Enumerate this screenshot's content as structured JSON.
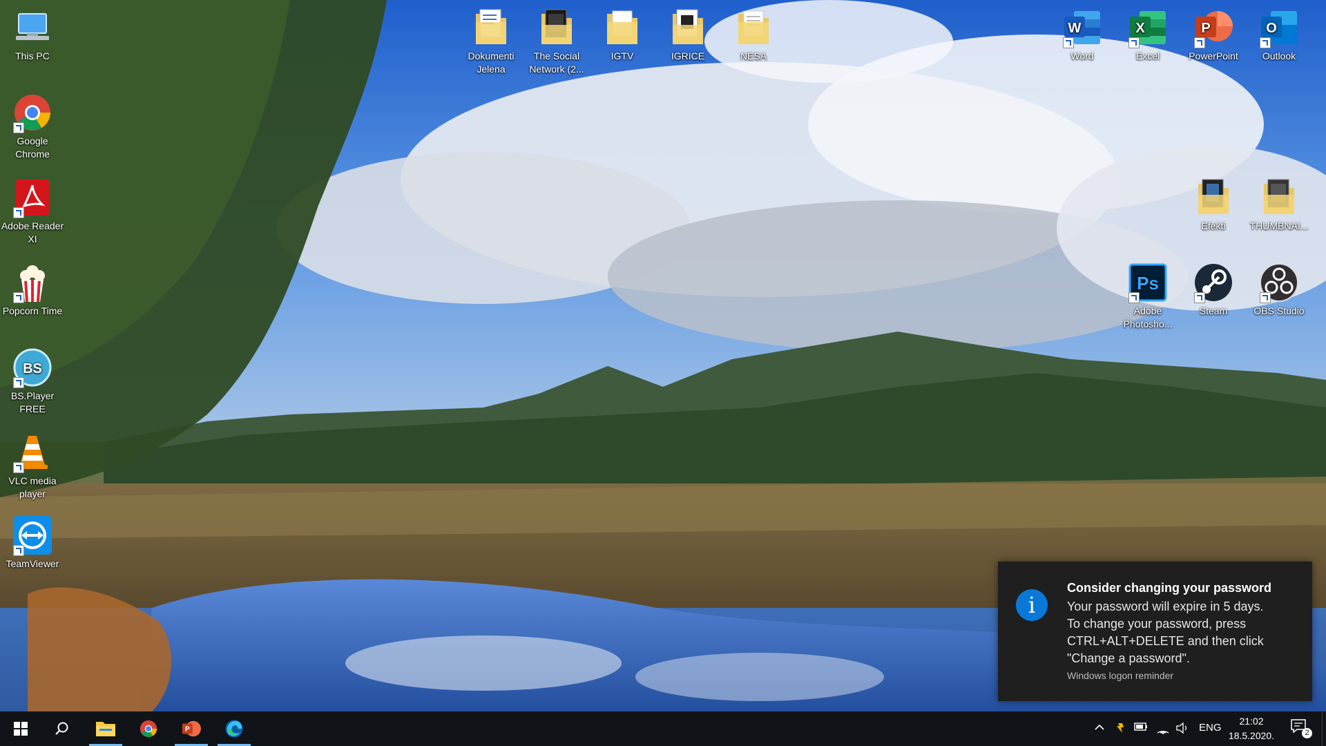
{
  "desktop": {
    "left_icons": [
      {
        "name": "this-pc",
        "label": "This PC",
        "icon": "computer-icon"
      },
      {
        "name": "google-chrome",
        "label": "Google Chrome",
        "icon": "chrome-icon"
      },
      {
        "name": "adobe-reader",
        "label": "Adobe Reader XI",
        "icon": "acrobat-icon"
      },
      {
        "name": "popcorn-time",
        "label": "Popcorn Time",
        "icon": "popcorn-icon"
      },
      {
        "name": "bsplayer",
        "label": "BS.Player FREE",
        "icon": "bsplayer-icon"
      },
      {
        "name": "vlc",
        "label": "VLC media player",
        "icon": "vlc-cone-icon"
      },
      {
        "name": "teamviewer",
        "label": "TeamViewer",
        "icon": "teamviewer-icon"
      }
    ],
    "top_icons": [
      {
        "name": "dokumenti-jelena",
        "label": "Dokumenti Jelena",
        "icon": "folder-icon"
      },
      {
        "name": "the-social-network",
        "label": "The Social Network (2...",
        "icon": "folder-icon"
      },
      {
        "name": "igtv",
        "label": "IGTV",
        "icon": "folder-icon"
      },
      {
        "name": "igrice",
        "label": "IGRICE",
        "icon": "folder-icon"
      },
      {
        "name": "nesa",
        "label": "NESA",
        "icon": "folder-icon"
      }
    ],
    "office_icons": [
      {
        "name": "word",
        "label": "Word",
        "icon": "word-icon",
        "color": "#2b579a",
        "letter": "W"
      },
      {
        "name": "excel",
        "label": "Excel",
        "icon": "excel-icon",
        "color": "#217346",
        "letter": "X"
      },
      {
        "name": "powerpoint",
        "label": "PowerPoint",
        "icon": "powerpoint-icon",
        "color": "#d24726",
        "letter": "P"
      },
      {
        "name": "outlook",
        "label": "Outlook",
        "icon": "outlook-icon",
        "color": "#0072c6",
        "letter": "O"
      }
    ],
    "right_icons": [
      {
        "name": "efekti",
        "label": "Efekti",
        "icon": "folder-icon"
      },
      {
        "name": "thumbnail",
        "label": "THUMBNAI...",
        "icon": "folder-icon"
      },
      {
        "name": "photoshop",
        "label": "Adobe Photosho...",
        "icon": "photoshop-icon",
        "letter": "Ps"
      },
      {
        "name": "steam",
        "label": "Steam",
        "icon": "steam-icon"
      },
      {
        "name": "obs",
        "label": "OBS Studio",
        "icon": "obs-icon"
      }
    ]
  },
  "toast": {
    "title": "Consider changing your password",
    "lines": [
      "Your password will expire in 5 days.",
      "To change your password, press",
      "CTRL+ALT+DELETE and then click",
      "\"Change a password\"."
    ],
    "source": "Windows logon reminder",
    "icon": "info-icon"
  },
  "taskbar": {
    "start": "windows-start-icon",
    "search": "search-icon",
    "pinned": [
      {
        "name": "file-explorer",
        "icon": "file-explorer-icon",
        "active": true
      },
      {
        "name": "chrome",
        "icon": "chrome-icon",
        "active": false
      },
      {
        "name": "powerpoint",
        "icon": "powerpoint-icon",
        "active": true
      },
      {
        "name": "edge",
        "icon": "edge-icon",
        "active": true
      }
    ],
    "tray": {
      "language": "ENG",
      "time": "21:02",
      "date": "18.5.2020.",
      "notification_count": "2"
    }
  }
}
